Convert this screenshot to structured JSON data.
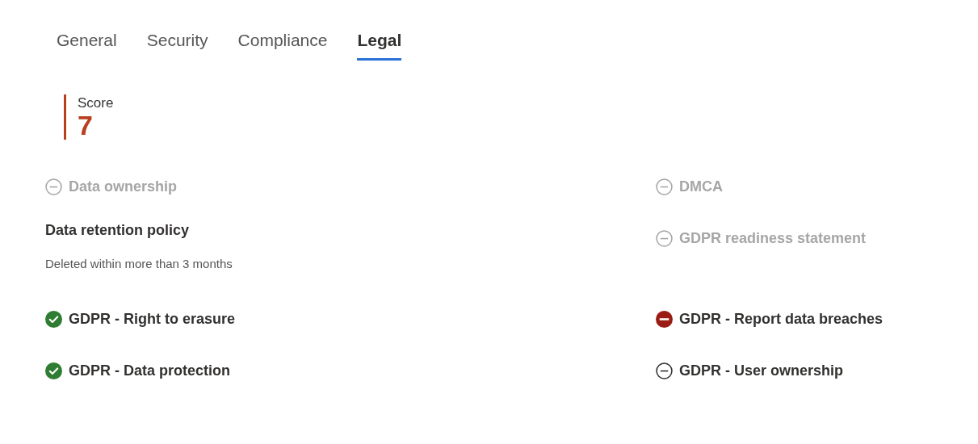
{
  "tabs": [
    {
      "label": "General",
      "selected": false
    },
    {
      "label": "Security",
      "selected": false
    },
    {
      "label": "Compliance",
      "selected": false
    },
    {
      "label": "Legal",
      "selected": true
    }
  ],
  "score": {
    "label": "Score",
    "value": "7"
  },
  "left_column": [
    {
      "kind": "unavailable",
      "label": "Data ownership"
    },
    {
      "kind": "info",
      "label": "Data retention policy",
      "value": "Deleted within more than 3 months"
    },
    {
      "kind": "pass",
      "label": "GDPR - Right to erasure"
    },
    {
      "kind": "pass",
      "label": "GDPR - Data protection"
    }
  ],
  "right_column": [
    {
      "kind": "unavailable",
      "label": "DMCA"
    },
    {
      "kind": "unavailable",
      "label": "GDPR readiness statement"
    },
    {
      "kind": "fail",
      "label": "GDPR - Report data breaches"
    },
    {
      "kind": "neutral",
      "label": "GDPR - User ownership"
    }
  ]
}
